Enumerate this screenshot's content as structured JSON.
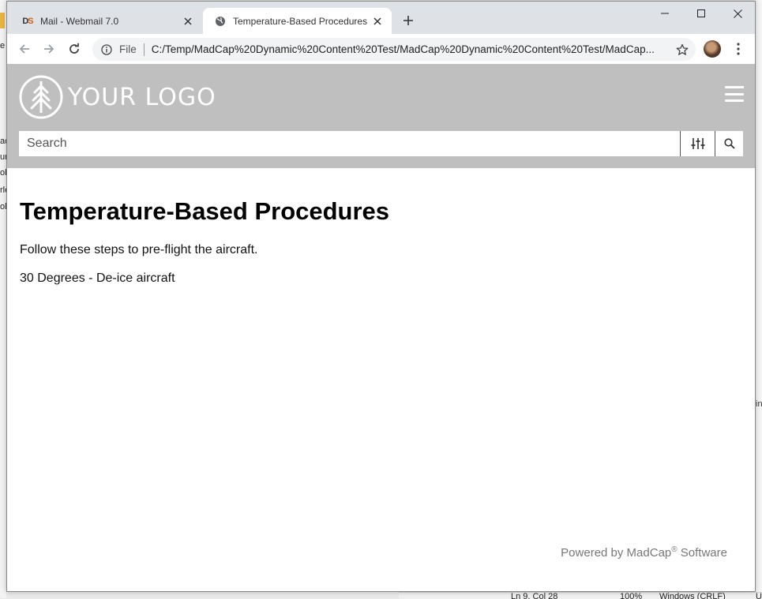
{
  "background_app": {
    "left_fragments": [
      "e",
      "ac",
      "ur",
      "ob",
      "rle",
      "oli"
    ],
    "right_fragment": "in",
    "status_bar": [
      "Ln 9, Col 28",
      "100%",
      "Windows (CRLF)",
      "U"
    ]
  },
  "browser": {
    "tabs": [
      {
        "title": "Mail - Webmail 7.0",
        "favicon": "DS",
        "active": false
      },
      {
        "title": "Temperature-Based Procedures",
        "favicon": "globe-icon",
        "active": true
      }
    ],
    "omnibox": {
      "scheme_label": "File",
      "url": "C:/Temp/MadCap%20Dynamic%20Content%20Test/MadCap%20Dynamic%20Content%20Test/MadCap..."
    }
  },
  "site": {
    "logo_text": "YOUR LOGO",
    "search_placeholder": "Search",
    "header_color": "#bfbfbf"
  },
  "content": {
    "heading": "Temperature-Based Procedures",
    "intro": "Follow these steps to pre-flight the aircraft.",
    "step": "30 Degrees - De-ice aircraft"
  },
  "footer": {
    "prefix": "Powered by MadCap",
    "registered": "®",
    "suffix": " Software"
  }
}
